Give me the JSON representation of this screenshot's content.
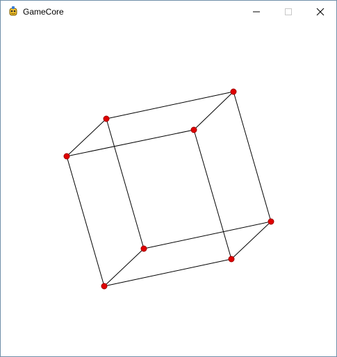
{
  "window": {
    "title": "GameCore",
    "icon": "pygame-snake-icon",
    "controls": [
      "minimize-icon",
      "maximize-icon",
      "close-icon"
    ]
  },
  "scene": {
    "background_color": "#ffffff",
    "edge_color": "#000000",
    "vertex_color": "#e00000",
    "vertex_stroke_color": "#a00000"
  }
}
